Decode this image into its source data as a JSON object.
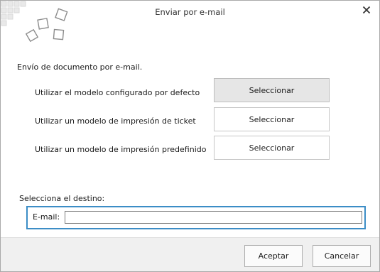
{
  "window": {
    "title": "Enviar por e-mail",
    "close_icon": "close-icon"
  },
  "main": {
    "section_title": "Envío de documento por e-mail.",
    "options": [
      {
        "label": "Utilizar el modelo configurado por defecto",
        "button_label": "Seleccionar"
      },
      {
        "label": "Utilizar un modelo de impresión de ticket",
        "button_label": "Seleccionar"
      },
      {
        "label": "Utilizar un modelo de impresión predefinido",
        "button_label": "Seleccionar"
      }
    ]
  },
  "destination": {
    "title": "Selecciona el destino:",
    "email_label": "E-mail:",
    "email_value": ""
  },
  "footer": {
    "accept_label": "Aceptar",
    "cancel_label": "Cancelar"
  },
  "colors": {
    "focus_border": "#3c8dc6",
    "active_button_bg": "#e6e6e6",
    "footer_bg": "#f0f0f0"
  }
}
